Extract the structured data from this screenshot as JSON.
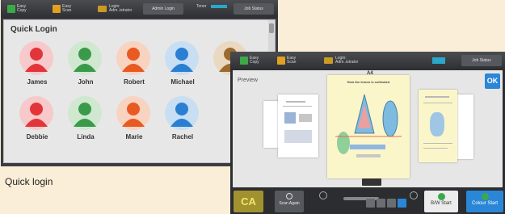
{
  "quick_login_screen": {
    "status_bar": {
      "left_items": [
        "Easy Copy",
        "Easy Scan"
      ],
      "admin_info": "Login: Adm..istrator",
      "center_button": "Admin Login",
      "toner_label": "Toner",
      "home_button": "Job Status"
    },
    "title": "Quick Login",
    "users": [
      {
        "name": "James",
        "color": "#e2353a",
        "bg": "#f7c9cb"
      },
      {
        "name": "John",
        "color": "#3a9a4a",
        "bg": "#cfe8cf"
      },
      {
        "name": "Robert",
        "color": "#e85a22",
        "bg": "#f8d3c0"
      },
      {
        "name": "Michael",
        "color": "#2a7fd2",
        "bg": "#c8def3"
      },
      {
        "name": "",
        "color": "#9a6a30",
        "bg": "#ead8c0"
      },
      {
        "name": "Debbie",
        "color": "#e2353a",
        "bg": "#f7c9cb"
      },
      {
        "name": "Linda",
        "color": "#3a9a4a",
        "bg": "#cfe8cf"
      },
      {
        "name": "Marie",
        "color": "#e85a22",
        "bg": "#f8d3c0"
      },
      {
        "name": "Rachel",
        "color": "#2a7fd2",
        "bg": "#c8def3"
      }
    ]
  },
  "caption": "Quick login",
  "preview_screen": {
    "status_bar": {
      "left_items": [
        "Easy Copy",
        "Easy Scan"
      ],
      "admin_info": "Login: Adm..istrator",
      "job_status": "Job Status"
    },
    "title": "Preview",
    "paper_size": "A4",
    "ok_label": "OK",
    "center_page_heading": "How the lemon is cultivated",
    "bottom": {
      "clear_all": "CA",
      "scan_again": "Scan Again",
      "bw_start": "B/W Start",
      "colour_start": "Colour Start"
    }
  },
  "colors": {
    "accent_blue": "#2a86d6",
    "clear_all": "#a0922f",
    "panel_bg": "#e7e7e7",
    "page_bg": "#fbeed8"
  }
}
